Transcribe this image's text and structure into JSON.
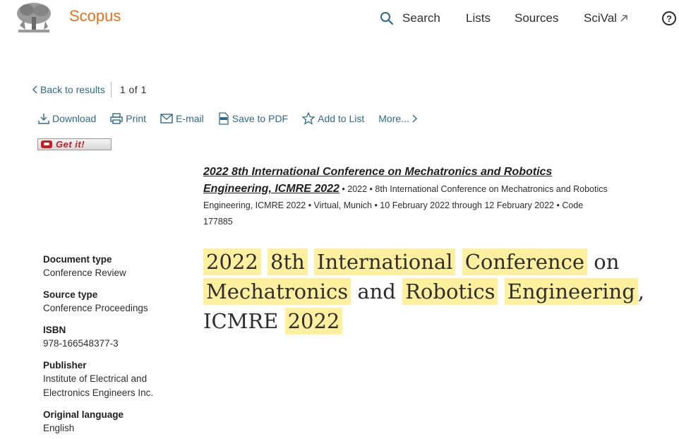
{
  "header": {
    "brand": "Scopus",
    "nav": {
      "search": "Search",
      "lists": "Lists",
      "sources": "Sources",
      "scival": "SciVal"
    },
    "help": "?"
  },
  "navigation": {
    "back": "Back to results",
    "pager": "1 of 1"
  },
  "actions": {
    "download": "Download",
    "print": "Print",
    "email": "E-mail",
    "save_pdf": "Save to PDF",
    "add_list": "Add to List",
    "more": "More..."
  },
  "getit": {
    "label": "Get it!"
  },
  "source": {
    "title_line1": "2022 8th International Conference on Mechatronics and Robotics",
    "title_line2": "Engineering, ICMRE 2022",
    "meta_line1": " • 2022 • 8th International Conference on Mechatronics and Robotics",
    "meta_line2": "Engineering, ICMRE 2022 • Virtual, Munich • 10 February 2022 through 12 February 2022 • Code",
    "meta_line3": "177885"
  },
  "details": {
    "document_type_label": "Document type",
    "document_type": "Conference Review",
    "source_type_label": "Source type",
    "source_type": "Conference Proceedings",
    "isbn_label": "ISBN",
    "isbn": "978-166548377-3",
    "publisher_label": "Publisher",
    "publisher_line1": "Institute of Electrical and",
    "publisher_line2": "Electronics Engineers Inc.",
    "language_label": "Original language",
    "language": "English"
  },
  "document": {
    "title_words": {
      "w1": "2022",
      "w2": "8th",
      "w3": "International",
      "w4": "Conference",
      "w5": "on",
      "w6": "Mechatronics",
      "w7": "and",
      "w8": "Robotics",
      "w9": "Engineering",
      "w10": ",",
      "w11": "ICMRE",
      "w12": "2022"
    }
  },
  "colors": {
    "brand": "#e9711c",
    "link": "#2e6a8c",
    "highlight": "#fff0a0",
    "getit_red": "#c41e20"
  }
}
